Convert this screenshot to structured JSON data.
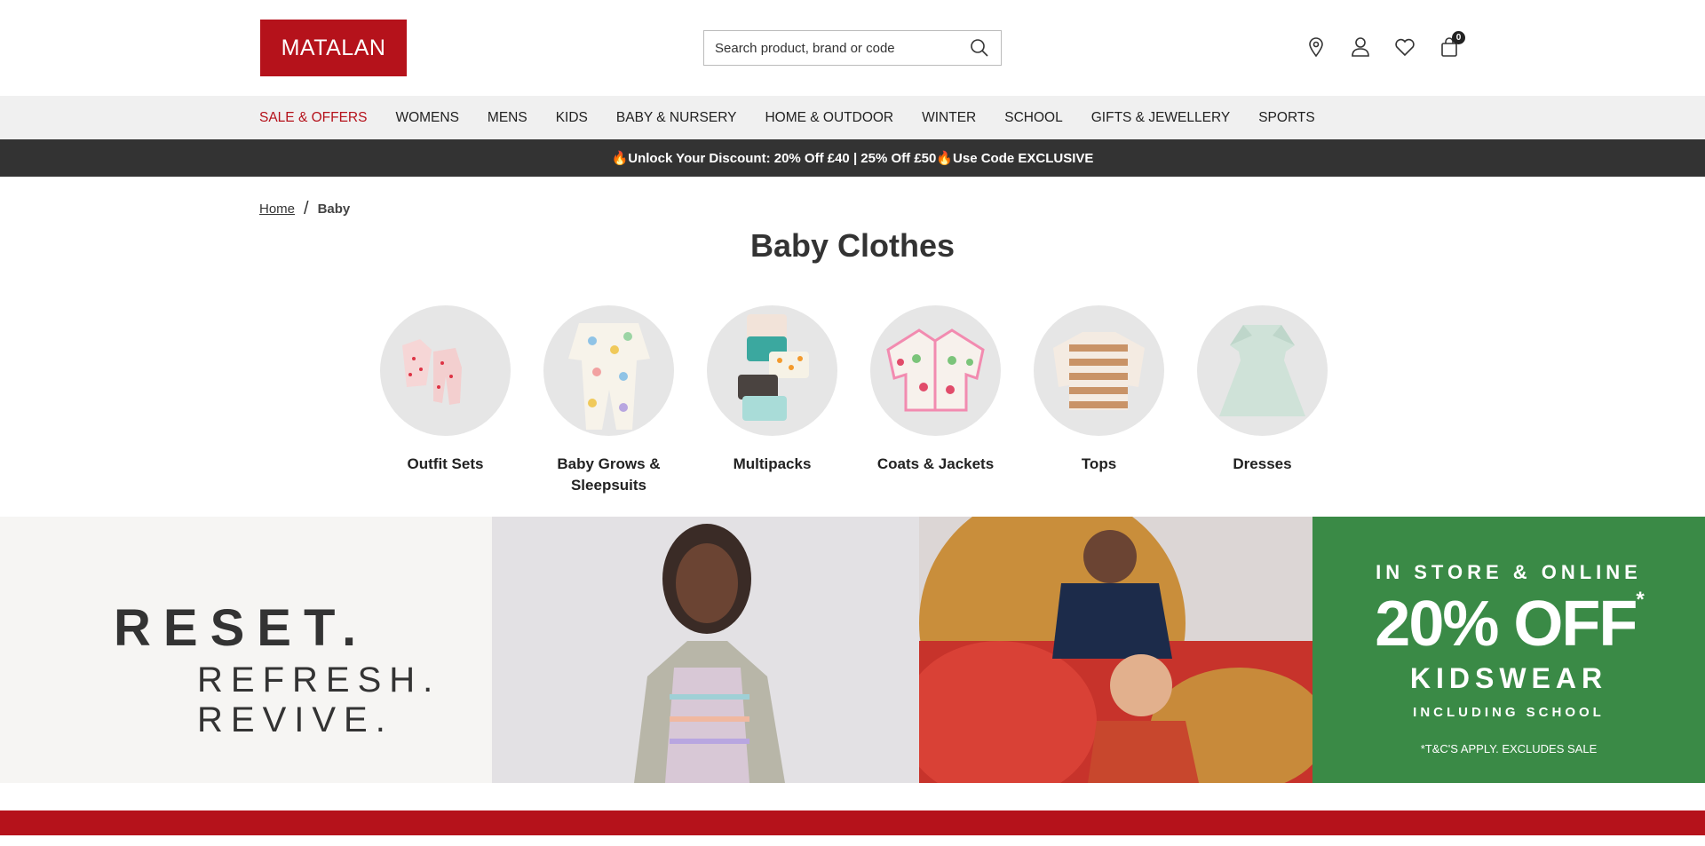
{
  "header": {
    "logo_text": "MATALAN",
    "search_placeholder": "Search product, brand or code",
    "bag_count": "0",
    "icons": [
      "store-locator-icon",
      "account-icon",
      "wishlist-icon",
      "bag-icon"
    ]
  },
  "nav": {
    "items": [
      {
        "label": "SALE & OFFERS",
        "highlight": true
      },
      {
        "label": "WOMENS"
      },
      {
        "label": "MENS"
      },
      {
        "label": "KIDS"
      },
      {
        "label": "BABY & NURSERY"
      },
      {
        "label": "HOME & OUTDOOR"
      },
      {
        "label": "WINTER"
      },
      {
        "label": "SCHOOL"
      },
      {
        "label": "GIFTS & JEWELLERY"
      },
      {
        "label": "SPORTS"
      }
    ]
  },
  "promo": {
    "text": "🔥Unlock Your Discount: 20% Off £40 | 25% Off £50🔥Use Code EXCLUSIVE"
  },
  "breadcrumb": {
    "home": "Home",
    "separator": "/",
    "current": "Baby"
  },
  "page_title": "Baby Clothes",
  "categories": [
    {
      "label": "Outfit Sets"
    },
    {
      "label": "Baby Grows & Sleepsuits"
    },
    {
      "label": "Multipacks"
    },
    {
      "label": "Coats & Jackets"
    },
    {
      "label": "Tops"
    },
    {
      "label": "Dresses"
    }
  ],
  "hero": {
    "headline": "RESET.",
    "subline": "REFRESH. REVIVE.",
    "offer_top": "IN STORE & ONLINE",
    "offer_main": "20% OFF",
    "offer_asterisk": "*",
    "offer_sub": "KIDSWEAR",
    "offer_sub2": "INCLUDING SCHOOL",
    "offer_terms": "*T&C'S APPLY. EXCLUDES SALE"
  },
  "colors": {
    "brand_red": "#b5121b",
    "promo_bg": "#333333",
    "offer_green": "#3a8a46",
    "nav_bg": "#f0f0f0"
  }
}
